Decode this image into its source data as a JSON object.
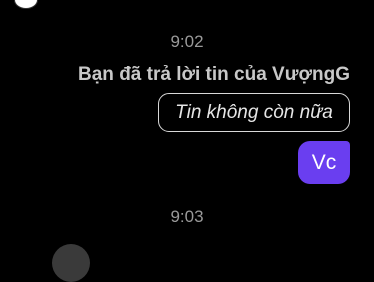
{
  "chat": {
    "timestamps": [
      "9:02",
      "9:03"
    ],
    "reply_label": "Bạn đã trả lời tin của VượngG",
    "quoted_message": "Tin không còn nữa",
    "sent_message": "Vc"
  },
  "colors": {
    "background": "#000000",
    "timestamp": "#9a9a9a",
    "reply_label": "#c8c8c8",
    "sent_bubble": "#6a3ef0",
    "quoted_border": "#d8d8d8"
  }
}
